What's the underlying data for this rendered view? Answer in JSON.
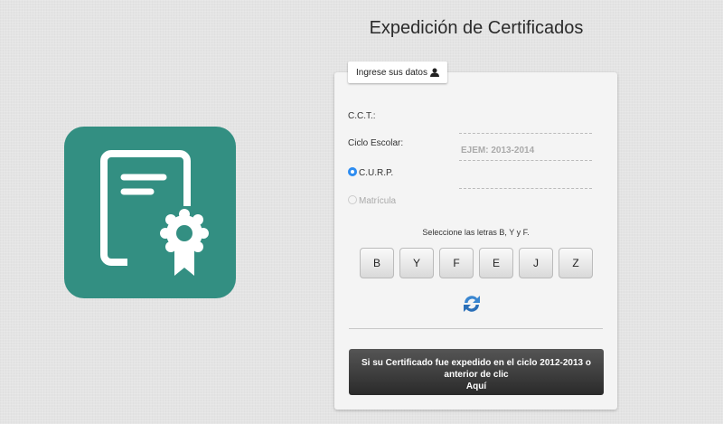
{
  "title": "Expedición de Certificados",
  "tab": {
    "label": "Ingrese sus datos",
    "icon": "user-icon"
  },
  "form": {
    "cct_label": "C.C.T.:",
    "ciclo_label": "Ciclo Escolar:",
    "ciclo_placeholder": "EJEM: 2013-2014",
    "curp_label": "C.U.R.P.",
    "matricula_label": "Matrícula",
    "selected_option": "C.U.R.P."
  },
  "captcha": {
    "hint": "Seleccione las letras B, Y y F.",
    "letters": [
      "B",
      "Y",
      "F",
      "E",
      "J",
      "Z"
    ]
  },
  "old_cert_button": {
    "line1": "Si su Certificado fue expedido en el ciclo 2012-2013 o",
    "line2": "anterior de clic",
    "line3": "Aquí"
  },
  "colors": {
    "brand": "#338f82",
    "radio": "#2d8cf0"
  }
}
